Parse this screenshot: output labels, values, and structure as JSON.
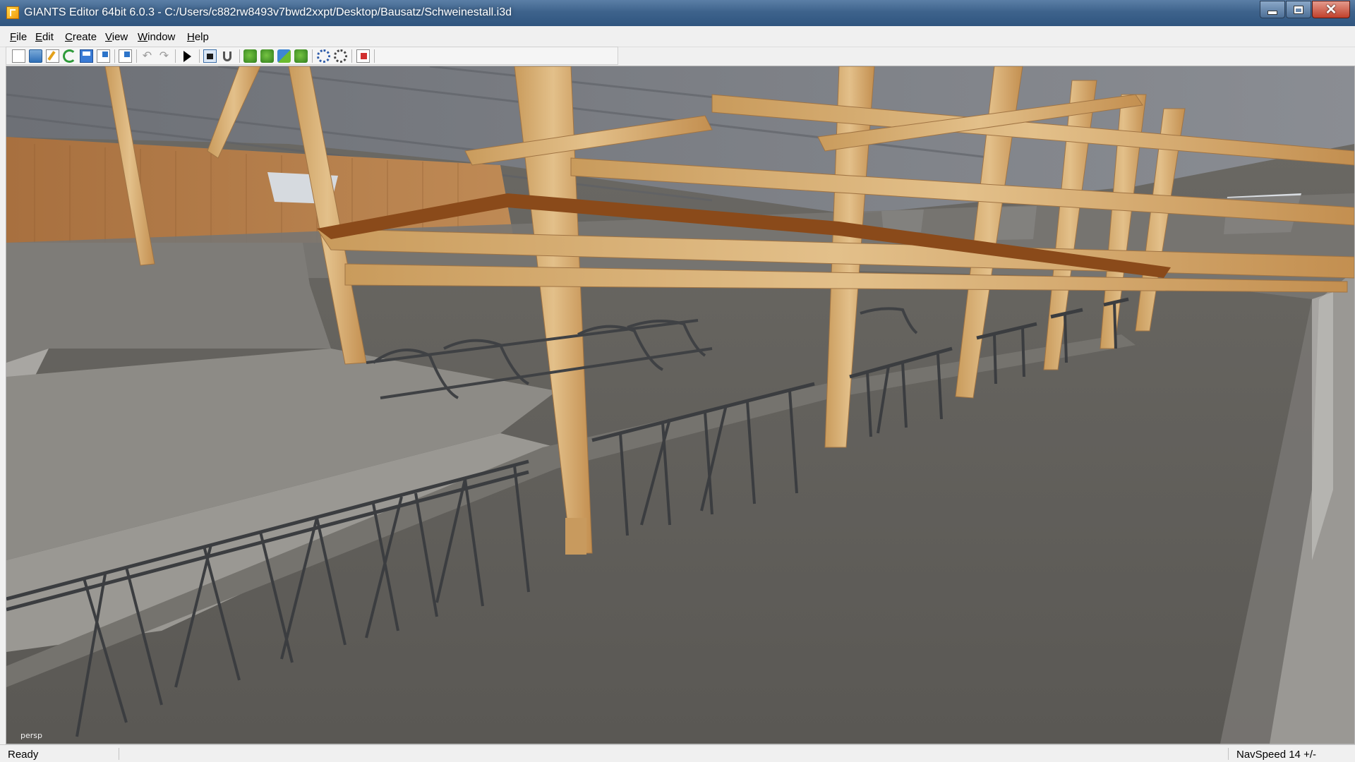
{
  "window": {
    "title": "GIANTS Editor 64bit 6.0.3 - C:/Users/c882rw8493v7bwd2xxpt/Desktop/Bausatz/Schweinestall.i3d",
    "icon": "giants-app-icon",
    "controls": [
      "minimize-icon",
      "maximize-icon",
      "close-icon"
    ]
  },
  "menu": {
    "items": [
      {
        "label": "File",
        "underline": "F",
        "rest": "ile"
      },
      {
        "label": "Edit",
        "underline": "E",
        "rest": "dit"
      },
      {
        "label": "Create",
        "underline": "C",
        "rest": "reate"
      },
      {
        "label": "View",
        "underline": "V",
        "rest": "iew"
      },
      {
        "label": "Window",
        "underline": "W",
        "rest": "indow"
      },
      {
        "label": "Help",
        "underline": "H",
        "rest": "elp"
      }
    ]
  },
  "toolbar": {
    "icons": [
      "new-file-icon",
      "open-folder-icon",
      "edit-file-icon",
      "refresh-icon",
      "save-icon",
      "export-icon",
      "import-icon",
      "undo-icon",
      "redo-icon",
      "play-icon",
      "camera-icon",
      "magnet-icon",
      "terrain-paint-icon",
      "foliage-paint-icon",
      "place-object-icon",
      "tree-icon",
      "settings-gear-icon",
      "plugin-gear-icon",
      "warning-log-icon"
    ]
  },
  "viewport": {
    "camera_label": "persp"
  },
  "status": {
    "left": "Ready",
    "right": "NavSpeed 14 +/-"
  }
}
